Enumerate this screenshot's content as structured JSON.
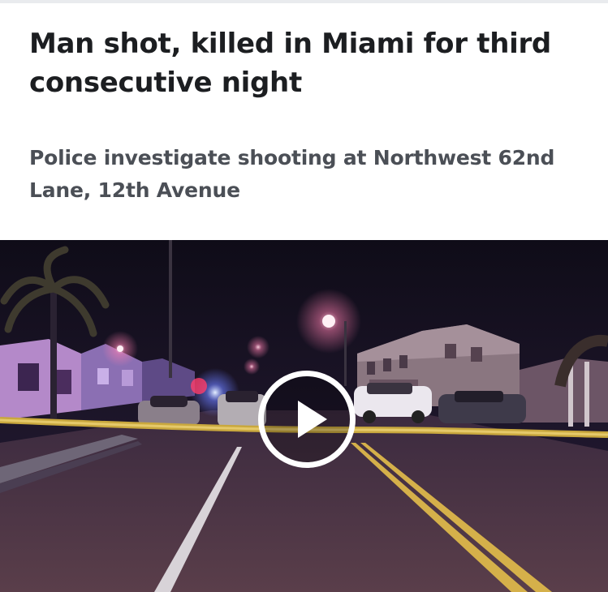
{
  "article": {
    "headline": "Man shot, killed in Miami for third consecutive night",
    "subheadline": "Police investigate shooting at Northwest 62nd Lane, 12th Avenue"
  },
  "video": {
    "play_icon": "play-icon"
  }
}
